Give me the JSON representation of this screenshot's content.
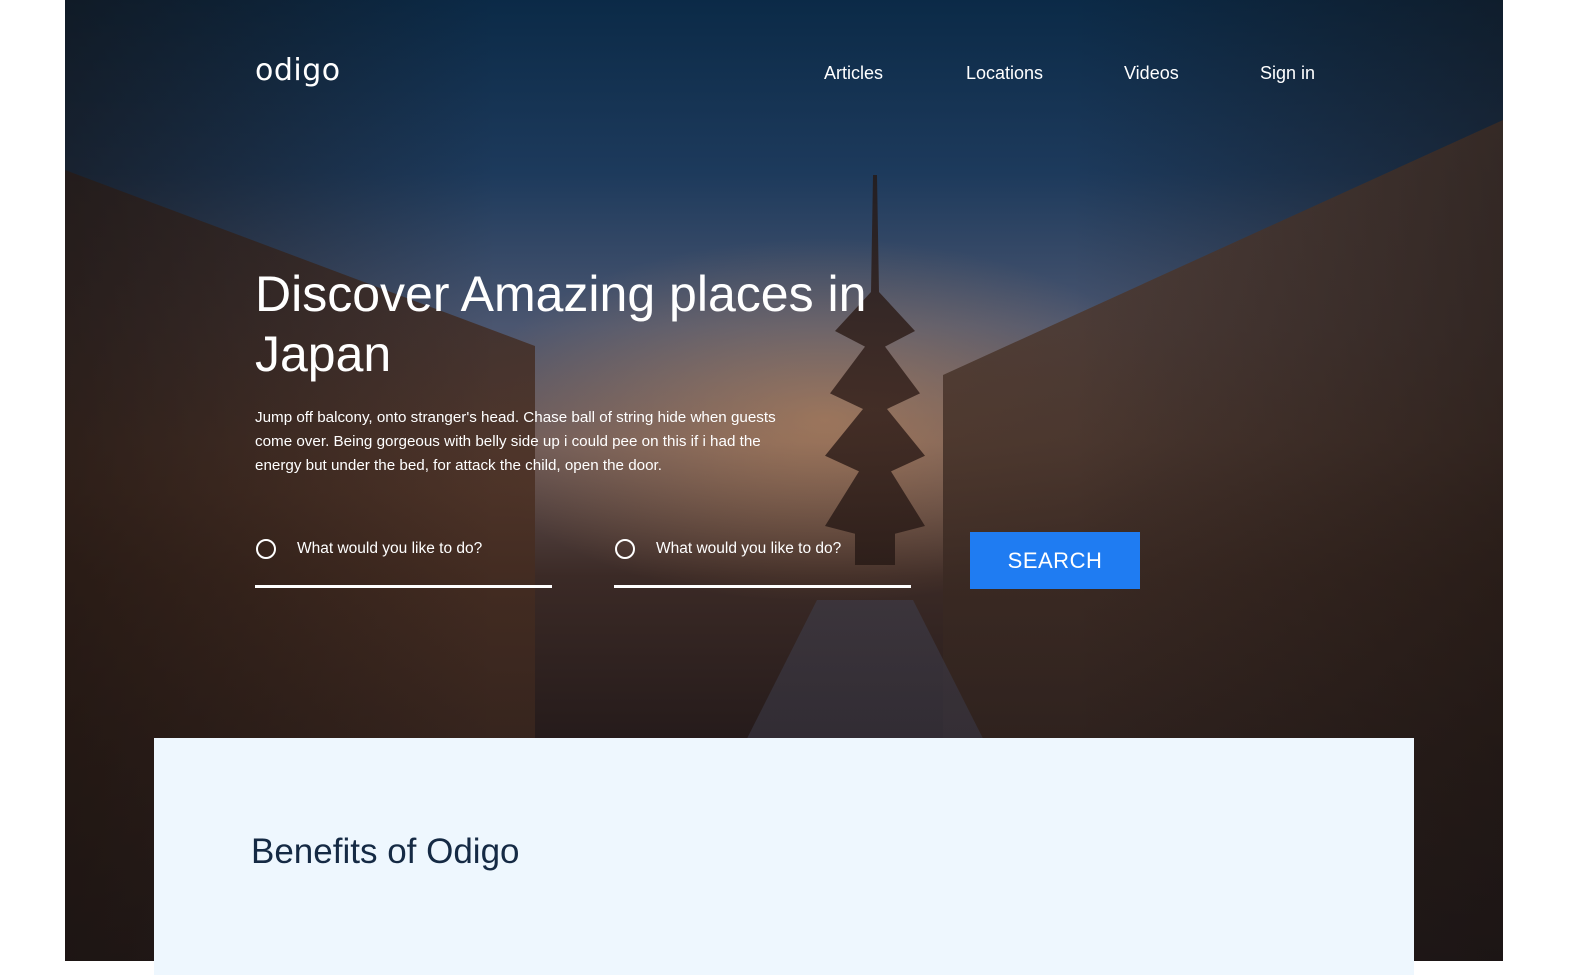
{
  "header": {
    "logo_text": "odigo",
    "nav": [
      {
        "label": "Articles"
      },
      {
        "label": "Locations"
      },
      {
        "label": "Videos"
      },
      {
        "label": "Sign in"
      }
    ]
  },
  "hero": {
    "headline": "Discover Amazing places in Japan",
    "description": "Jump off balcony, onto stranger's head. Chase ball of string hide when guests come over. Being gorgeous with belly side up i could pee on this if i had the energy but under the bed, for attack the child, open the door.",
    "search": {
      "fields": [
        {
          "placeholder": "What would you like to do?",
          "value": "",
          "icon": "radio-circle-icon"
        },
        {
          "placeholder": "What would you like to do?",
          "value": "",
          "icon": "radio-circle-icon"
        }
      ],
      "button_label": "SEARCH"
    }
  },
  "benefits": {
    "title": "Benefits of Odigo"
  },
  "colors": {
    "accent": "#1f7cf2",
    "benefits_bg": "#eef7fe",
    "title_text": "#152a44"
  }
}
